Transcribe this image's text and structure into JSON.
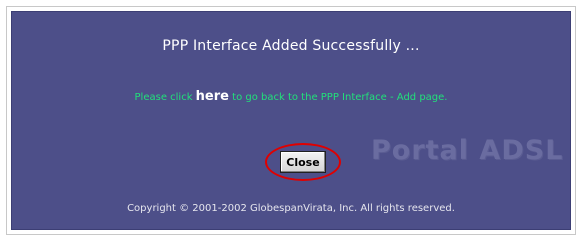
{
  "dialog": {
    "title": "PPP Interface Added Successfully ...",
    "message_prefix": "Please click ",
    "here_link": "here",
    "message_suffix": " to go back to the PPP Interface - Add page.",
    "close_label": "Close",
    "watermark": "Portal ADSL",
    "copyright": "Copyright © 2001-2002 GlobespanVirata, Inc. All rights reserved."
  },
  "colors": {
    "panel_background": "#4d4f89",
    "message_text": "#22e07a",
    "highlight_ring": "#e00000"
  }
}
